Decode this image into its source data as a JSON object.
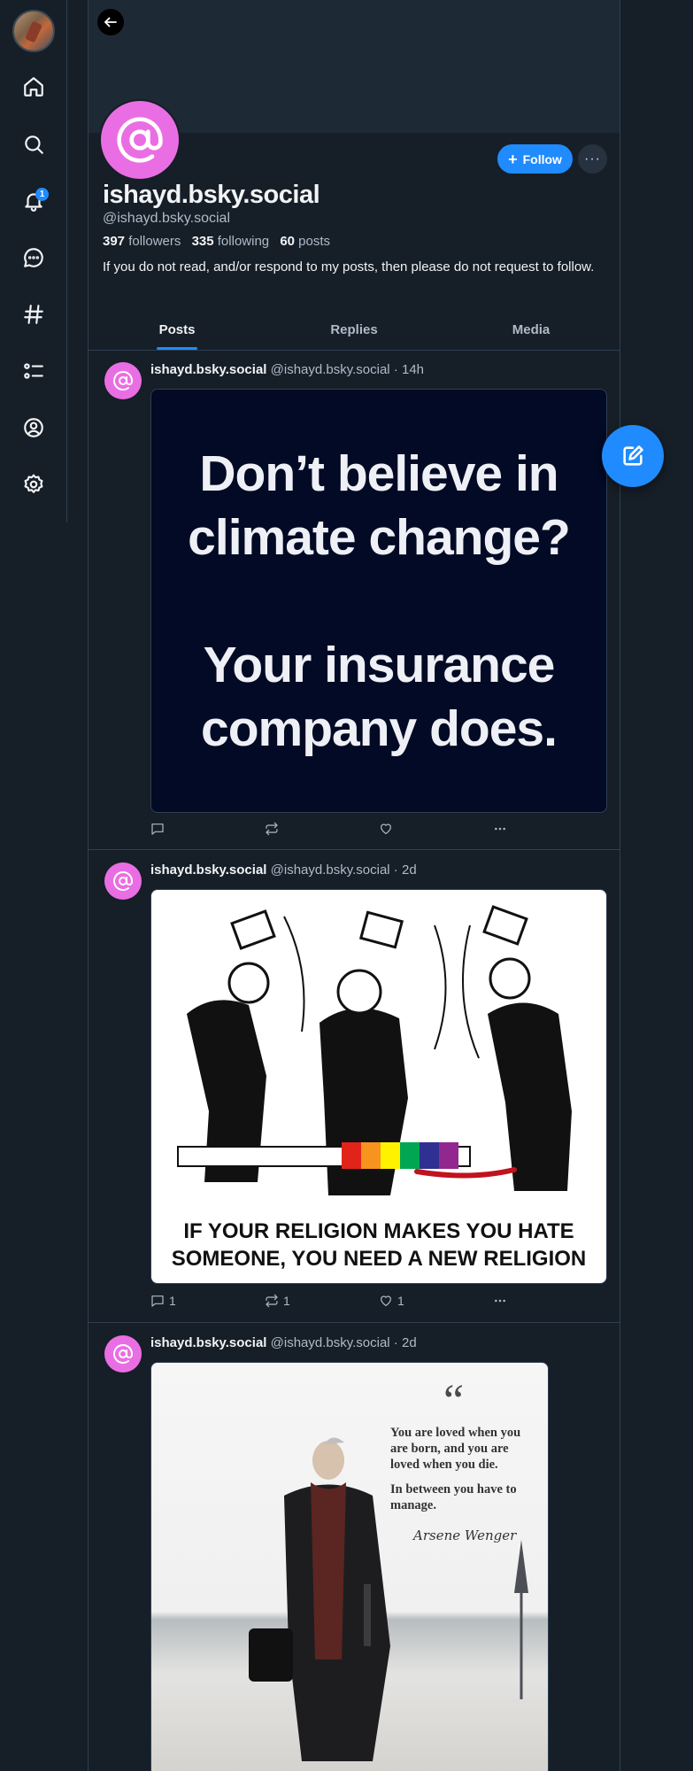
{
  "nav": {
    "items": [
      {
        "icon": "home-icon"
      },
      {
        "icon": "search-icon"
      },
      {
        "icon": "bell-icon"
      },
      {
        "icon": "chat-icon"
      },
      {
        "icon": "hashtag-icon"
      },
      {
        "icon": "list-icon"
      },
      {
        "icon": "profile-icon"
      },
      {
        "icon": "gear-icon"
      }
    ],
    "notification_count": "1"
  },
  "profile": {
    "display_name": "ishayd.bsky.social",
    "handle": "@ishayd.bsky.social",
    "followers_count": "397",
    "followers_label": "followers",
    "following_count": "335",
    "following_label": "following",
    "posts_count": "60",
    "posts_label": "posts",
    "bio": "If you do not read, and/or respond to my posts, then please do not request to follow.",
    "follow_label": "Follow",
    "more_label": "···",
    "avatar_color": "#ea6ee3"
  },
  "tabs": [
    {
      "label": "Posts",
      "active": true
    },
    {
      "label": "Replies",
      "active": false
    },
    {
      "label": "Media",
      "active": false
    }
  ],
  "posts": [
    {
      "author": "ishayd.bsky.social",
      "handle_time": "@ishayd.bsky.social · 14h",
      "image_lines": [
        "Don’t believe in",
        "climate change?",
        "Your insurance",
        "company does."
      ],
      "reply_count": "",
      "repost_count": "",
      "like_count": ""
    },
    {
      "author": "ishayd.bsky.social",
      "handle_time": "@ishayd.bsky.social · 2d",
      "image_caption_1": "IF YOUR RELIGION MAKES YOU HATE",
      "image_caption_2": "SOMEONE, YOU NEED A NEW RELIGION",
      "reply_count": "1",
      "repost_count": "1",
      "like_count": "1"
    },
    {
      "author": "ishayd.bsky.social",
      "handle_time": "@ishayd.bsky.social · 2d",
      "quote_mark": "“",
      "quote_line_1": "You are loved when you are born, and you are loved when you die.",
      "quote_line_2": "In between you have to manage.",
      "quote_author": "Arsene Wenger"
    }
  ],
  "colors": {
    "background": "#161e27",
    "accent": "#208bfe",
    "border": "#2e4052",
    "muted_text": "#aebbc9"
  }
}
